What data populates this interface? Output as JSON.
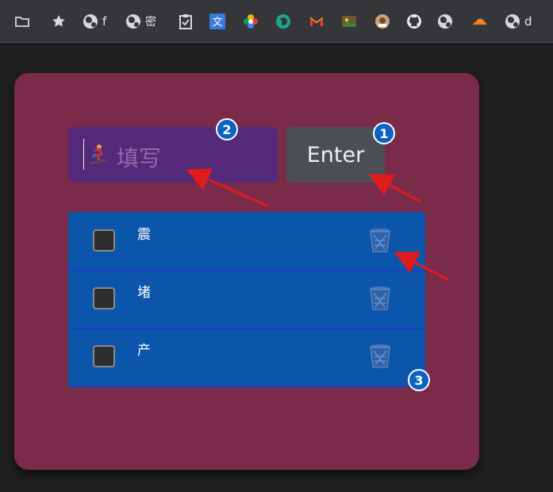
{
  "bookmarks": [
    {
      "icon": "folder-icon",
      "label": ""
    },
    {
      "icon": "star-icon",
      "label": ""
    },
    {
      "icon": "globe-icon",
      "label": "f"
    },
    {
      "icon": "globe-icon",
      "label": "密"
    },
    {
      "icon": "clipboard-check-icon",
      "label": ""
    },
    {
      "icon": "translate-icon",
      "label": ""
    },
    {
      "icon": "photos-icon",
      "label": ""
    },
    {
      "icon": "p-circle-icon",
      "label": ""
    },
    {
      "icon": "gmail-icon",
      "label": ""
    },
    {
      "icon": "image-app-icon",
      "label": ""
    },
    {
      "icon": "avatar-app-icon",
      "label": ""
    },
    {
      "icon": "github-icon",
      "label": ""
    },
    {
      "icon": "globe-icon",
      "label": ""
    },
    {
      "icon": "cloudflare-icon",
      "label": ""
    },
    {
      "icon": "globe-icon",
      "label": "d"
    }
  ],
  "form": {
    "placeholder": "填写",
    "enter_label": "Enter"
  },
  "todos": [
    {
      "text": "震",
      "checked": false
    },
    {
      "text": "堵",
      "checked": false
    },
    {
      "text": "产",
      "checked": false
    }
  ],
  "annotations": [
    "1",
    "2",
    "3"
  ],
  "colors": {
    "card": "#7a2b4a",
    "input": "#55297a",
    "list": "#0b56ab",
    "arrow": "#e01b1b",
    "badge": "#0b63c4"
  }
}
